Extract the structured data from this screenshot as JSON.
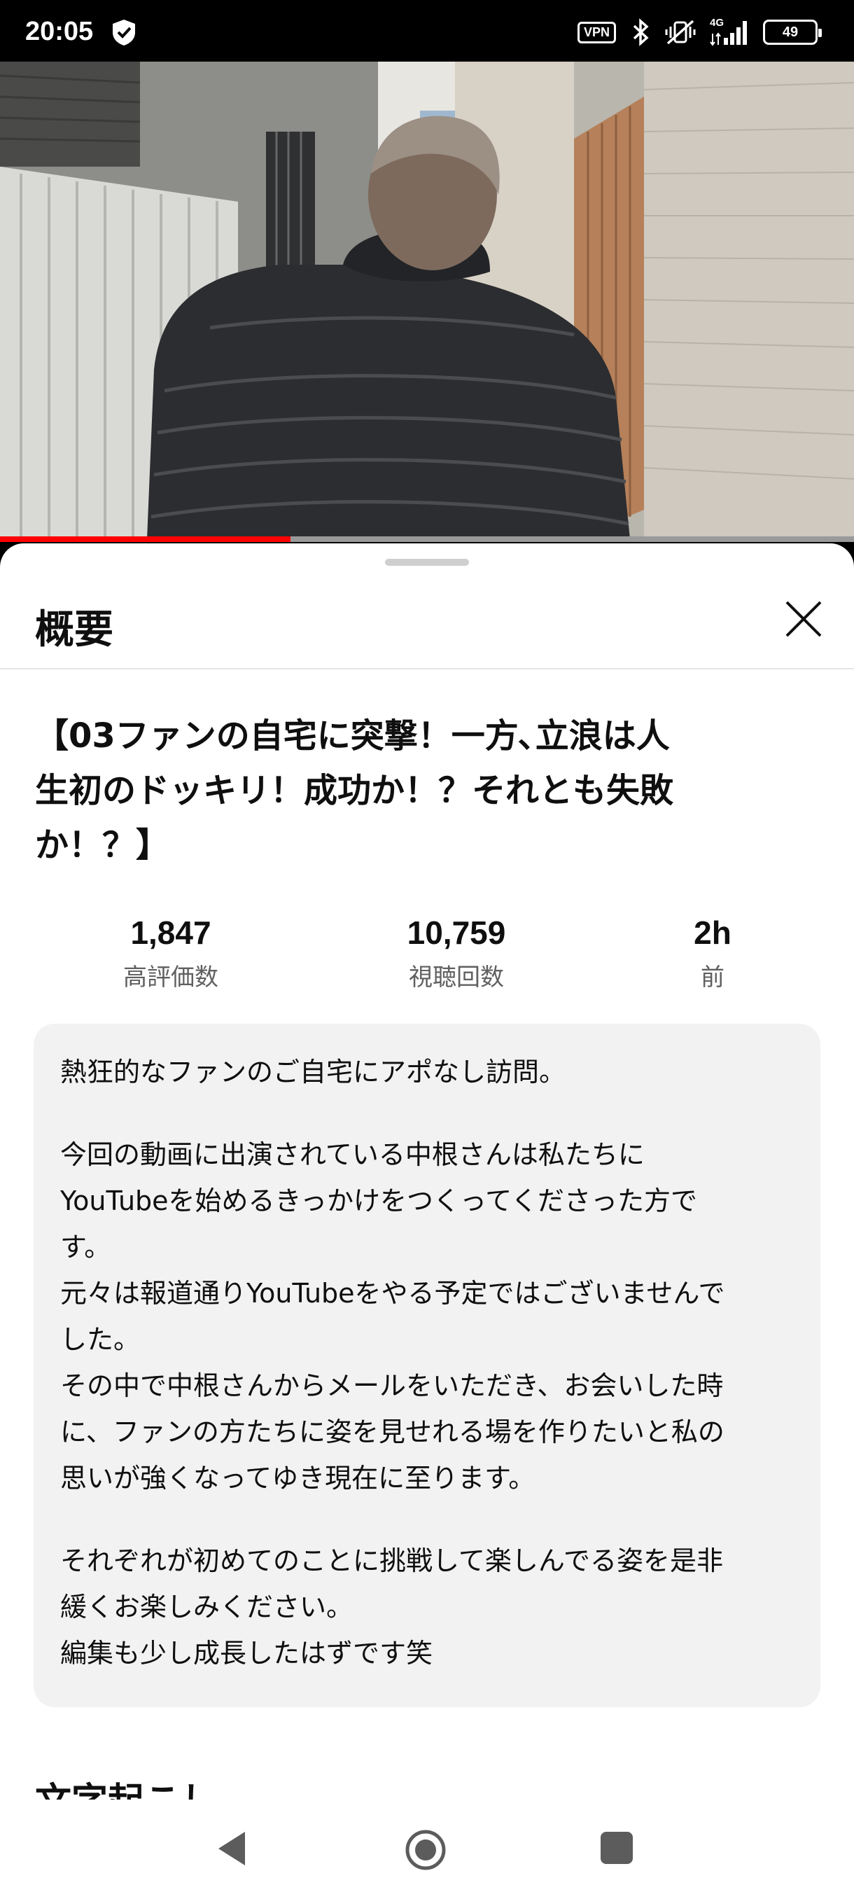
{
  "status_bar": {
    "time": "20:05",
    "vpn_label": "VPN",
    "network_label": "4G",
    "battery_level": "49",
    "icons": [
      "shield-check-icon",
      "vpn-icon",
      "bluetooth-icon",
      "vibrate-off-icon",
      "signal-icon",
      "battery-icon"
    ]
  },
  "video": {
    "progress_fraction": 0.34,
    "progress_color": "#ff0000"
  },
  "sheet": {
    "title": "概要",
    "close_icon": "close-icon"
  },
  "video_title": {
    "line1": "【03ファンの自宅に突撃！一方､立浪は人",
    "line2": "生初のドッキリ！成功か！？それとも失敗",
    "line3": "か！？】"
  },
  "stats": [
    {
      "value": "1,847",
      "label": "高評価数"
    },
    {
      "value": "10,759",
      "label": "視聴回数"
    },
    {
      "value": "2h",
      "label": "前"
    }
  ],
  "description": {
    "lines": [
      "熱狂的なファンのご自宅にアポなし訪問。",
      "",
      "今回の動画に出演されている中根さんは私たちに",
      "YouTubeを始めるきっかけをつくってくださった方で",
      "す。",
      "元々は報道通りYouTubeをやる予定ではございませんで",
      "した。",
      "その中で中根さんからメールをいただき、お会いした時",
      "に、ファンの方たちに姿を見せれる場を作りたいと私の",
      "思いが強くなってゆき現在に至ります。",
      "",
      "それぞれが初めてのことに挑戦して楽しんでる姿を是非",
      "緩くお楽しみください。",
      "編集も少し成長したはずです笑"
    ]
  },
  "next_section": {
    "title": "文字起こし"
  },
  "nav_bar": {
    "icons": [
      "back-icon",
      "home-icon",
      "recents-icon"
    ]
  }
}
